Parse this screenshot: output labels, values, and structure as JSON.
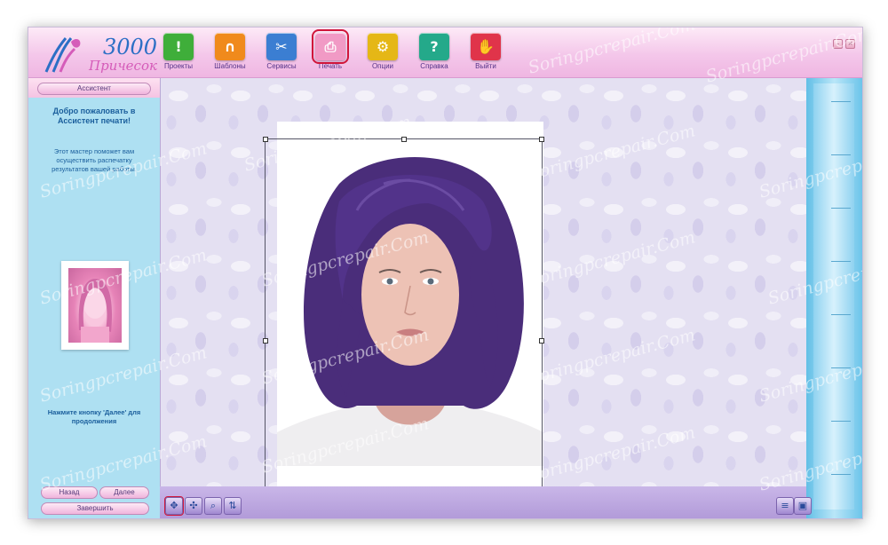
{
  "app": {
    "logo_number": "3000",
    "logo_word": "Причесок"
  },
  "toolbar": [
    {
      "label": "Проекты",
      "icon": "projects-icon",
      "color": "#3fae3a",
      "glyph": "!"
    },
    {
      "label": "Шаблоны",
      "icon": "templates-icon",
      "color": "#f08a1c",
      "glyph": "∩"
    },
    {
      "label": "Сервисы",
      "icon": "services-icon",
      "color": "#3b7ed2",
      "glyph": "✂"
    },
    {
      "label": "Печать",
      "icon": "print-icon",
      "color": "#f19ac5",
      "glyph": "⎙"
    },
    {
      "label": "Опции",
      "icon": "options-icon",
      "color": "#e5b716",
      "glyph": "⚙"
    },
    {
      "label": "Справка",
      "icon": "help-icon",
      "color": "#24a98a",
      "glyph": "?"
    },
    {
      "label": "Выйти",
      "icon": "exit-icon",
      "color": "#e0344a",
      "glyph": "✋"
    }
  ],
  "left_panel": {
    "title_button": "Ассистент",
    "welcome": "Добро пожаловать в Ассистент печати!",
    "description": "Этот мастер поможет вам осуществить распечатку результатов вашей работы.",
    "hint": "Нажмите кнопку 'Далее' для продолжения",
    "back_button": "Назад",
    "next_button": "Далее",
    "finish_button": "Завершить"
  },
  "watermark": "Soringpcrepair.Com"
}
